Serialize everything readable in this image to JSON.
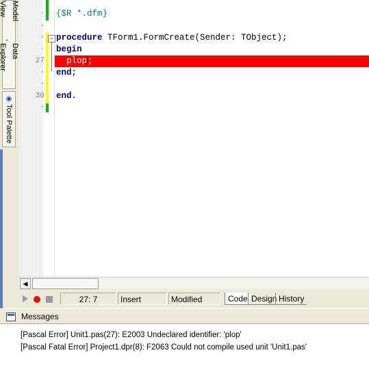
{
  "dock": {
    "tab_model_view": "Model View",
    "tab_data_explorer": "Data Explorer",
    "tab_tool_palette": "Tool Palette"
  },
  "editor": {
    "lines": [
      {
        "num": "",
        "text": "{$R *.dfm}"
      },
      {
        "num": "",
        "text": ""
      },
      {
        "num": "",
        "kw": "procedure",
        "text": " TForm1.FormCreate(Sender: TObject);"
      },
      {
        "num": "",
        "kw": "begin"
      },
      {
        "num": "27",
        "text": "plop;"
      },
      {
        "num": "",
        "kw": "end",
        "text": ";"
      },
      {
        "num": "",
        "text": ""
      },
      {
        "num": "30",
        "kw": "end",
        "text": "."
      }
    ],
    "comment_text": "{$R *.dfm}",
    "proc_kw": "procedure",
    "proc_text": " TForm1.FormCreate(Sender: TObject);",
    "begin_kw": "begin",
    "error_ident": "plop",
    "error_semicolon": ";",
    "end_kw": "end",
    "end_semicolon": ";",
    "final_end_kw": "end",
    "final_dot": ".",
    "line_27": "27",
    "line_30": "30",
    "error_line_color": "#ff0000"
  },
  "status": {
    "cursor_pos": "27:  7",
    "mode": "Insert",
    "state": "Modified",
    "tab_code": "Code",
    "tab_design": "Design",
    "tab_history": "History"
  },
  "messages": {
    "title": "Messages",
    "items": [
      "[Pascal Error] Unit1.pas(27): E2003 Undeclared identifier: 'plop'",
      "[Pascal Fatal Error] Project1.dpr(8): F2063 Could not compile used unit 'Unit1.pas'"
    ]
  }
}
